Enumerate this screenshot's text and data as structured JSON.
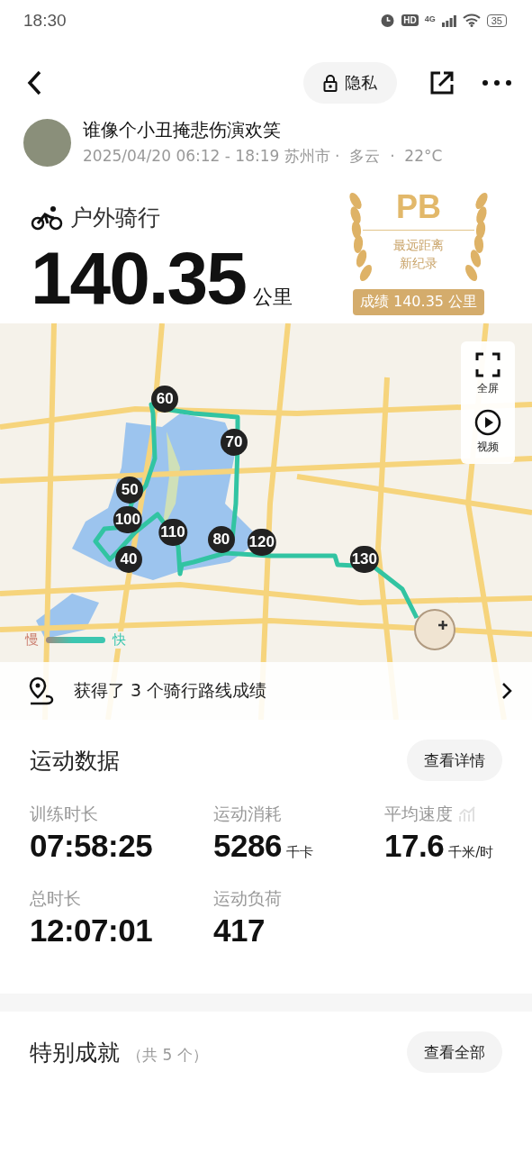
{
  "status_bar": {
    "time": "18:30",
    "hd": "HD",
    "network": "4G",
    "battery": "35"
  },
  "nav": {
    "privacy_label": "隐私"
  },
  "user": {
    "name": "谁像个小丑掩悲伤演欢笑",
    "meta": "2025/04/20 06:12 - 18:19 苏州市 ·  多云  ·  22°C"
  },
  "activity": {
    "type": "户外骑行",
    "distance": "140.35",
    "unit": "公里"
  },
  "pb_badge": {
    "title": "PB",
    "line1": "最远距离",
    "line2": "新纪录",
    "result": "成绩 140.35 公里"
  },
  "map": {
    "controls": [
      {
        "label": "全屏",
        "kind": "fullscreen"
      },
      {
        "label": "视频",
        "kind": "video"
      }
    ],
    "markers": [
      {
        "label": "60"
      },
      {
        "label": "70"
      },
      {
        "label": "50"
      },
      {
        "label": "100"
      },
      {
        "label": "110"
      },
      {
        "label": "80"
      },
      {
        "label": "120"
      },
      {
        "label": "40"
      },
      {
        "label": "130"
      }
    ],
    "legend": {
      "slow": "慢",
      "fast": "快"
    },
    "route_banner": "获得了 3 个骑行路线成绩"
  },
  "stats": {
    "title": "运动数据",
    "button": "查看详情",
    "items": [
      {
        "label": "训练时长",
        "value": "07:58:25"
      },
      {
        "label": "运动消耗",
        "value": "5286",
        "unit": "千卡"
      },
      {
        "label": "平均速度",
        "value": "17.6",
        "unit": "千米/时",
        "trend_icon": true
      },
      {
        "label": "总时长",
        "value": "12:07:01"
      },
      {
        "label": "运动负荷",
        "value": "417"
      }
    ]
  },
  "achievements": {
    "title": "特别成就",
    "count": "（共 5 个）",
    "button": "查看全部"
  }
}
